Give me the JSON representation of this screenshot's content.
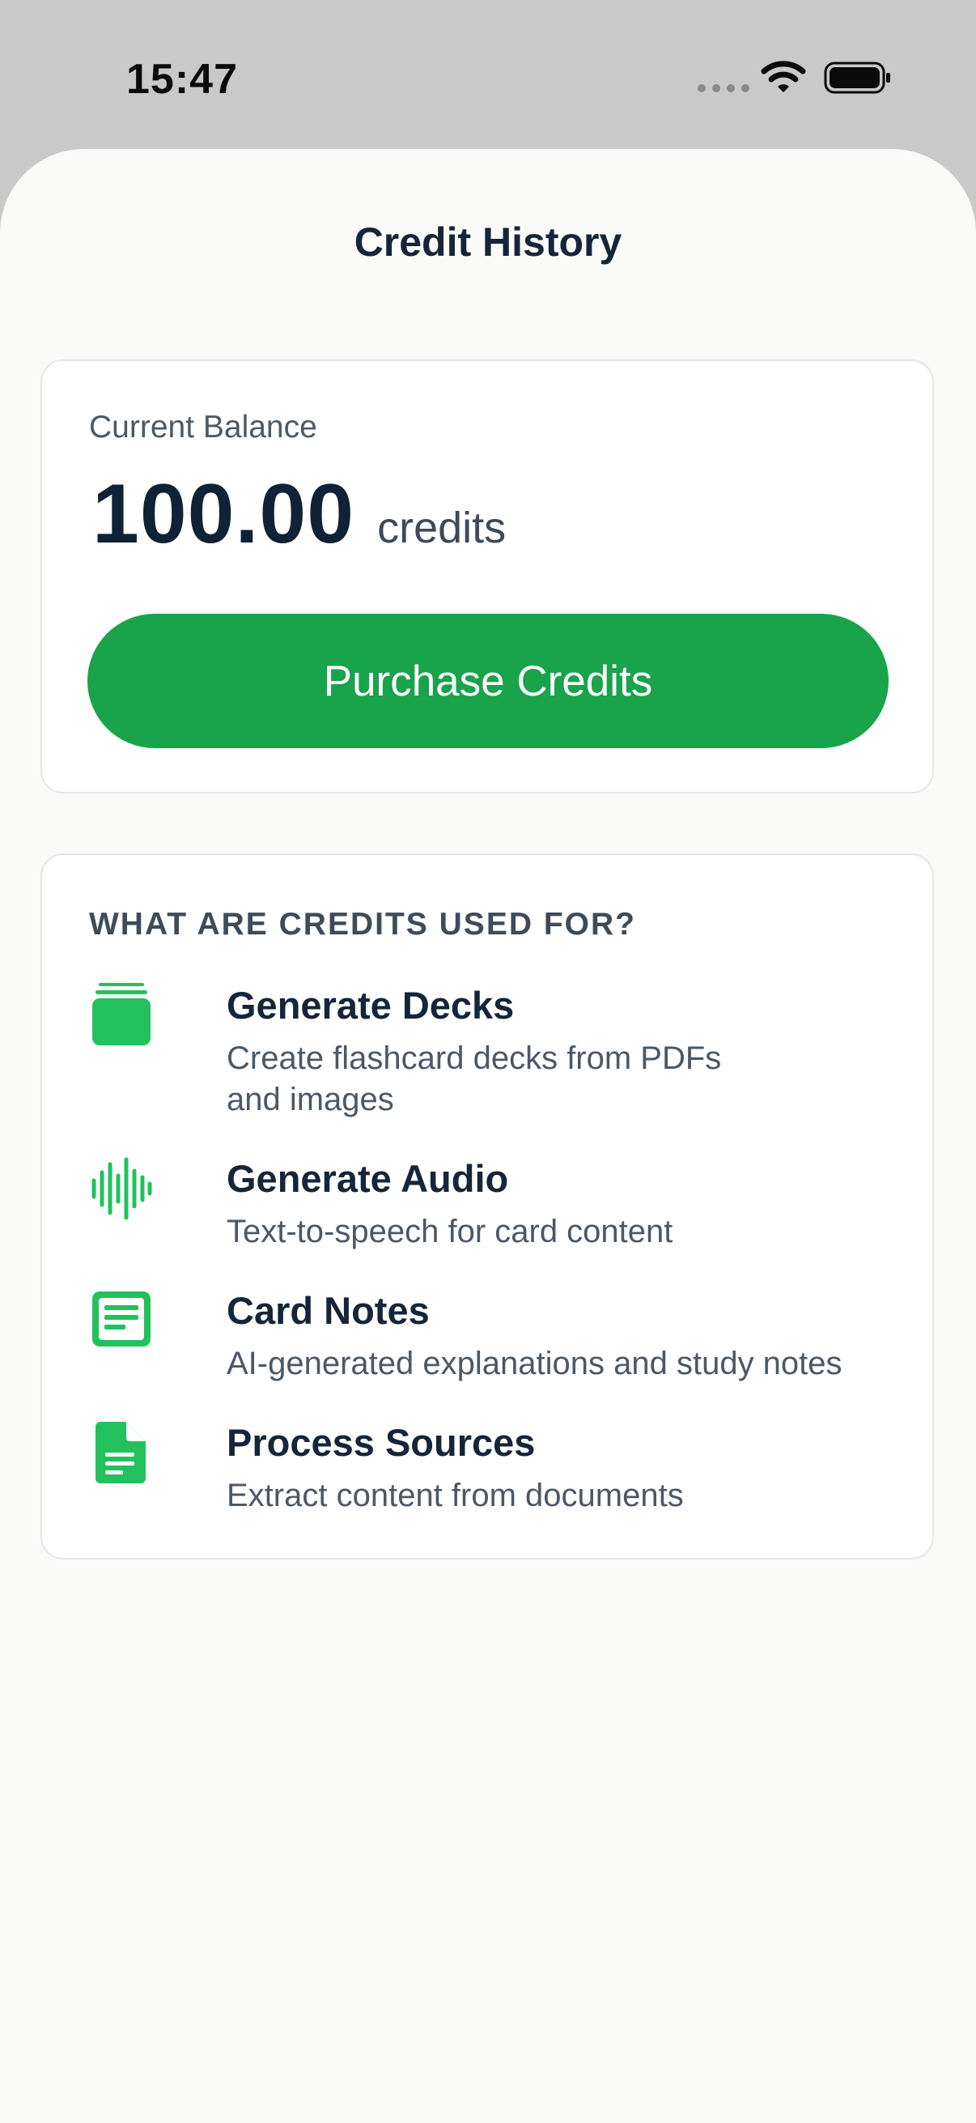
{
  "status_bar": {
    "time": "15:47"
  },
  "sheet": {
    "title": "Credit History"
  },
  "balance": {
    "label": "Current Balance",
    "amount": "100.00",
    "unit": "credits",
    "purchase_label": "Purchase Credits"
  },
  "info": {
    "heading": "WHAT ARE CREDITS USED FOR?",
    "items": [
      {
        "title": "Generate Decks",
        "description": "Create flashcard decks from PDFs and images",
        "icon": "stack-icon"
      },
      {
        "title": "Generate Audio",
        "description": "Text-to-speech for card content",
        "icon": "waveform-icon"
      },
      {
        "title": "Card Notes",
        "description": "AI-generated explanations and study notes",
        "icon": "notes-icon"
      },
      {
        "title": "Process Sources",
        "description": "Extract content from documents",
        "icon": "document-icon"
      }
    ]
  },
  "colors": {
    "accent": "#19a34a",
    "icon_green": "#22c15e",
    "text_dark": "#15253a",
    "text_muted": "#4b5866",
    "background": "#fafaf8"
  }
}
